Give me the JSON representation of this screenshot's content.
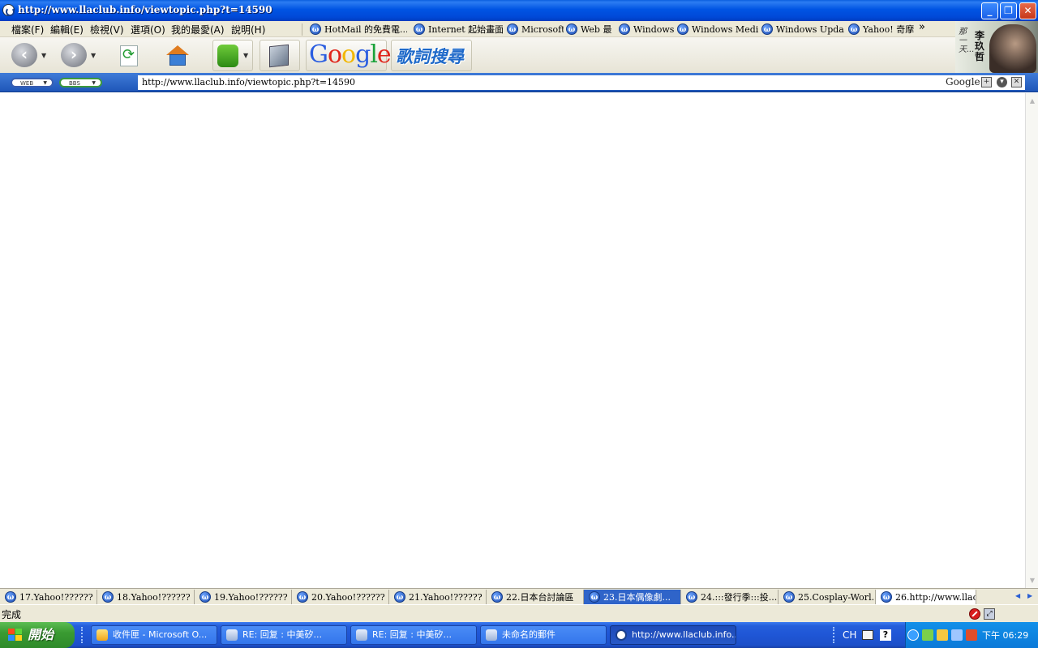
{
  "window": {
    "title": "http://www.llaclub.info/viewtopic.php?t=14590",
    "buttons": {
      "minimize": "_",
      "maximize": "❐",
      "close": "✕"
    }
  },
  "menu": [
    "檔案(F)",
    "編輯(E)",
    "檢視(V)",
    "選項(O)",
    "我的最愛(A)",
    "說明(H)"
  ],
  "links": [
    "HotMail 的免費電...",
    "Internet 起始畫面",
    "Microsoft",
    "Web 最",
    "Windows",
    "Windows Media",
    "Windows Update",
    "Yahoo! 奇摩"
  ],
  "links_more": "»",
  "toolbar": {
    "back_icon": "back-arrow",
    "forward_icon": "forward-arrow",
    "google_logo": [
      "G",
      "o",
      "o",
      "g",
      "l",
      "e"
    ],
    "lyrics_search": "歌詞搜尋"
  },
  "banner": {
    "name": "李玖哲",
    "script": "那一天..."
  },
  "address": {
    "web_button": "WEB",
    "bbs_button": "BBS",
    "url": "http://www.llaclub.info/viewtopic.php?t=14590",
    "search_label": "Google"
  },
  "page_tabs": [
    "17.Yahoo!?????? ...",
    "18.Yahoo!?????? ...",
    "19.Yahoo!??????",
    "20.Yahoo!?????? ...",
    "21.Yahoo!?????? ...",
    "22.日本台討論區",
    "23.日本偶像劇...",
    "24.:::發行季:::投...",
    "25.Cosplay-Worl...",
    "26.http://www.llacl..."
  ],
  "active_tab_index": 6,
  "status": {
    "text": "完成"
  },
  "taskbar": {
    "start_label": "開始",
    "tasks": [
      "收件匣 - Microsoft O...",
      "RE: 回复 : 中美矽...",
      "RE: 回复 : 中美矽...",
      "未命名的郵件",
      "http://www.llaclub.info..."
    ],
    "language": "CH",
    "clock": "下午 06:29"
  },
  "colors": {
    "title_bar": "#0054e3",
    "taskbar": "#245edb",
    "start_button": "#3a9b32",
    "active_tab": "#2f64c9"
  }
}
